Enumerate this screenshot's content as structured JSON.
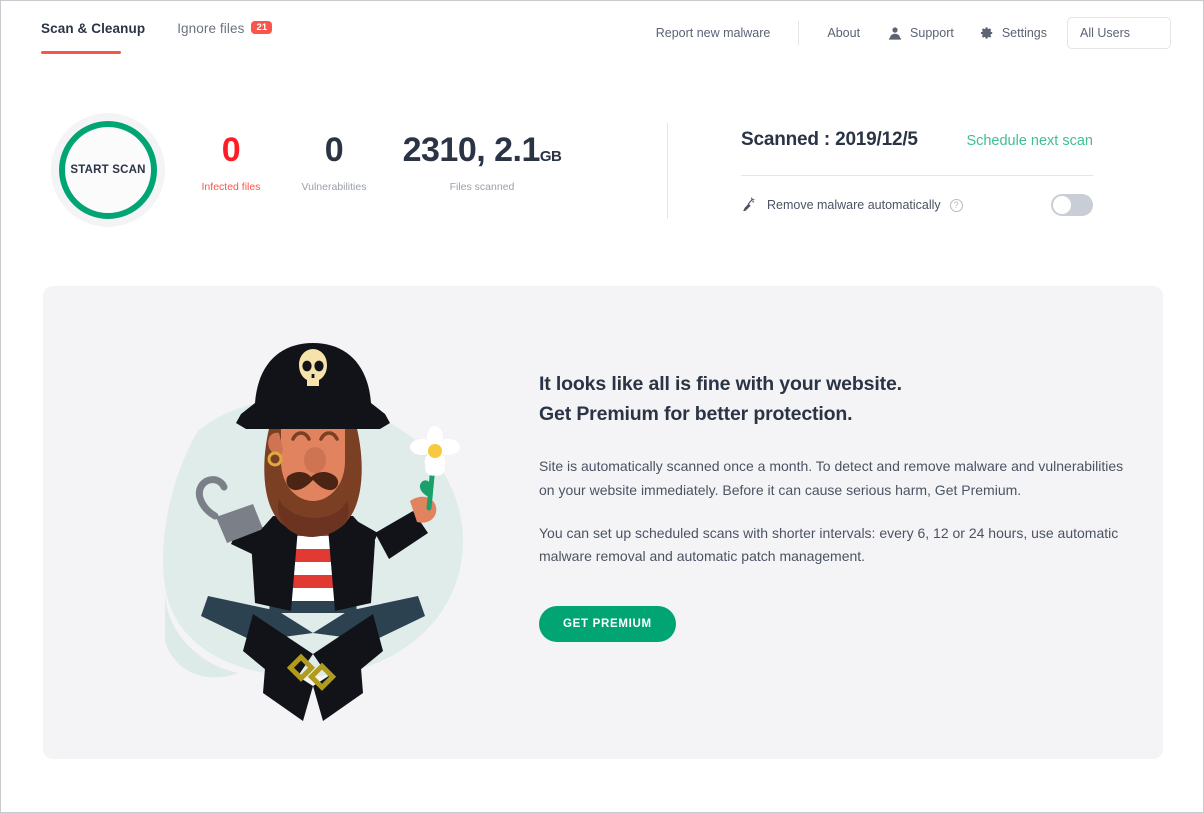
{
  "header": {
    "tabs": [
      {
        "label": "Scan & Cleanup",
        "active": true,
        "badge": ""
      },
      {
        "label": "Ignore files",
        "active": false,
        "badge": "21"
      }
    ],
    "links": [
      {
        "label": "Report new malware",
        "icon": ""
      },
      {
        "label": "About",
        "icon": ""
      },
      {
        "label": "Support",
        "icon": "user-icon"
      },
      {
        "label": "Settings",
        "icon": "gear-icon"
      }
    ],
    "user_filter": {
      "value": "All Users"
    }
  },
  "summary": {
    "scan_button_label": "START SCAN",
    "stats": [
      {
        "value": "0",
        "unit": "",
        "label": "Infected files",
        "color": "#ff1d25",
        "label_color": "#f8564a"
      },
      {
        "value": "0",
        "unit": "",
        "label": "Vulnerabilities",
        "color": "#2b3445",
        "label_color": "#9aa0ab"
      },
      {
        "value": "2310, 2.1",
        "unit": "GB",
        "label": "Files scanned",
        "color": "#2b3445",
        "label_color": "#9aa0ab"
      }
    ],
    "scanned_label": "Scanned : 2019/12/5",
    "schedule_link": "Schedule next scan",
    "auto_remove_label": "Remove malware automatically",
    "auto_remove_help": "?",
    "auto_remove_on": false
  },
  "promo": {
    "heading_line1": "It looks like all is fine with your website.",
    "heading_line2": "Get Premium for better protection.",
    "paragraph1": "Site is automatically scanned once a month. To detect and remove malware and vulnerabilities on your website immediately. Before it can cause serious harm, Get Premium.",
    "paragraph2": "You can set up scheduled scans with shorter intervals: every 6, 12 or 24 hours, use automatic malware removal and automatic patch management.",
    "cta_label": "GET PREMIUM",
    "illustration": "pirate-meditating-illustration"
  },
  "colors": {
    "accent_green": "#00a573",
    "accent_green_light": "#3fbf92",
    "accent_red": "#f8564a",
    "danger_red": "#ff1d25",
    "text_dark": "#2b3445",
    "text_muted": "#9aa0ab",
    "card_bg": "#f4f4f6"
  }
}
